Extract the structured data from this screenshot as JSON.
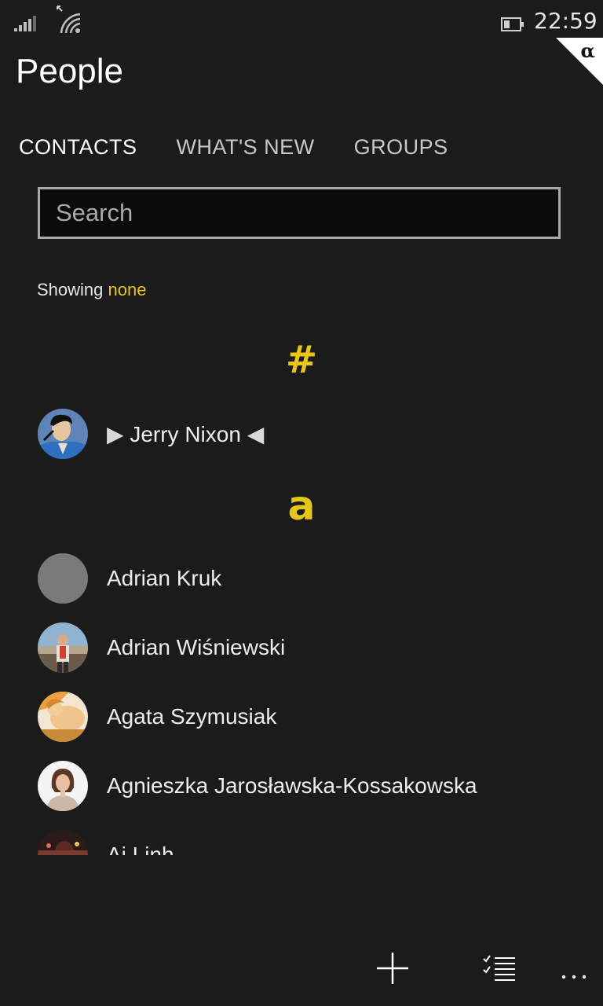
{
  "status": {
    "time": "22:59",
    "alpha_badge": "α"
  },
  "app": {
    "title": "People"
  },
  "tabs": [
    "CONTACTS",
    "WHAT'S NEW",
    "GROUPS"
  ],
  "search": {
    "placeholder": "Search",
    "value": ""
  },
  "filter": {
    "label": "Showing",
    "value": "none"
  },
  "groups": [
    {
      "header": "#",
      "contacts": [
        {
          "name": "Jerry Nixon",
          "marker_left": "▶",
          "marker_right": "◀"
        }
      ]
    },
    {
      "header": "a",
      "contacts": [
        {
          "name": "Adrian Kruk"
        },
        {
          "name": "Adrian Wiśniewski"
        },
        {
          "name": "Agata Szymusiak"
        },
        {
          "name": "Agnieszka Jarosławska-Kossakowska"
        },
        {
          "name": "Ai Linh"
        }
      ]
    }
  ],
  "appbar": {
    "icons": [
      "add-icon",
      "select-icon",
      "more-icon"
    ]
  },
  "colors": {
    "accent": "#e6c619",
    "background": "#1b1b1b"
  }
}
